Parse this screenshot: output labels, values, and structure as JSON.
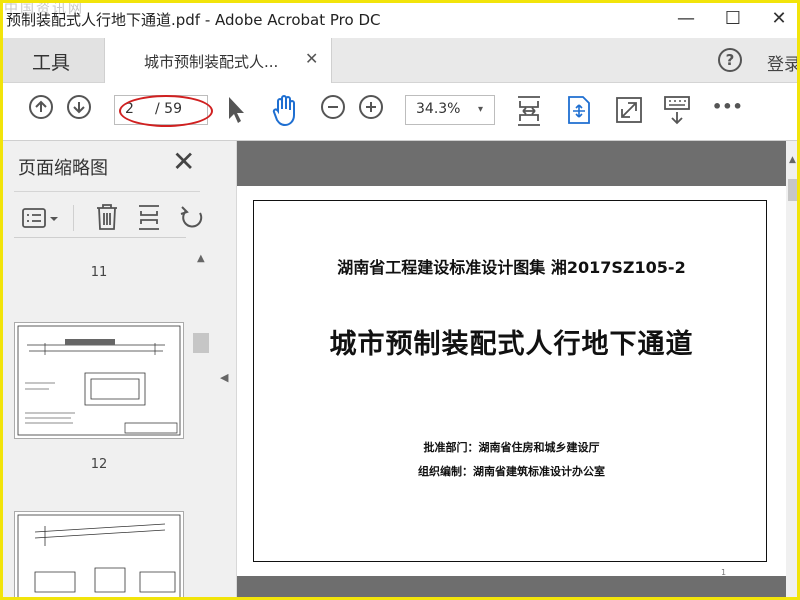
{
  "window": {
    "title": "预制装配式人行地下通道.pdf - Adobe Acrobat Pro DC",
    "watermark": "中国资讯网",
    "controls": {
      "minimize": "—",
      "maximize": "☐",
      "close": "✕"
    }
  },
  "tabs": {
    "tools_label": "工具",
    "document_label": "城市预制装配式人...",
    "document_close": "✕",
    "help_label": "?",
    "login_label": "登录"
  },
  "toolbar": {
    "page_current": "2",
    "page_total": "/ 59",
    "zoom_value": "34.3%",
    "zoom_arrow": "▾",
    "more_label": "•••",
    "highlight_color": "#d02020"
  },
  "panel": {
    "title": "页面缩略图",
    "close_label": "✕",
    "thumbnails": [
      {
        "number": "11"
      },
      {
        "number": "12"
      },
      {
        "number": ""
      }
    ]
  },
  "document": {
    "line1": "湖南省工程建设标准设计图集  湘2017SZ105-2",
    "main_title": "城市预制装配式人行地下通道",
    "approve": "批准部门：湖南省住房和城乡建设厅",
    "compile": "组织编制：湖南省建筑标准设计办公室",
    "page_number": "1"
  }
}
